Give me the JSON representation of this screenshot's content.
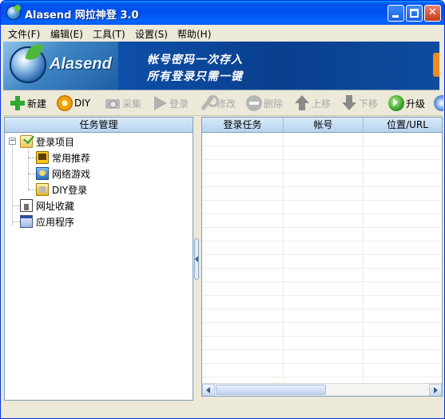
{
  "window": {
    "title": "Alasend 网拉神登 3.0"
  },
  "menu": [
    {
      "label": "文件(F)"
    },
    {
      "label": "编辑(E)"
    },
    {
      "label": "工具(T)"
    },
    {
      "label": "设置(S)"
    },
    {
      "label": "帮助(H)"
    }
  ],
  "banner": {
    "logo_text": "Alasend",
    "slogan_line1": "帐号密码一次存入",
    "slogan_line2": "所有登录只需一键"
  },
  "toolbar": [
    {
      "label": "新建",
      "icon": "plus-icon",
      "enabled": true
    },
    {
      "label": "DIY",
      "icon": "gear-icon",
      "enabled": true
    },
    {
      "label": "采集",
      "icon": "camera-icon",
      "enabled": false
    },
    {
      "label": "登录",
      "icon": "play-icon",
      "enabled": false
    },
    {
      "label": "修改",
      "icon": "wrench-icon",
      "enabled": false
    },
    {
      "label": "删除",
      "icon": "no-entry-icon",
      "enabled": false
    },
    {
      "label": "上移",
      "icon": "arrow-up-icon",
      "enabled": false
    },
    {
      "label": "下移",
      "icon": "arrow-down-icon",
      "enabled": false
    },
    {
      "label": "升级",
      "icon": "upgrade-icon",
      "enabled": true
    }
  ],
  "left_panel": {
    "title": "任务管理",
    "tree": {
      "root": {
        "label": "登录项目",
        "expanded": true,
        "expander": "−"
      },
      "children": [
        {
          "label": "常用推荐"
        },
        {
          "label": "网络游戏"
        },
        {
          "label": "DIY登录"
        }
      ],
      "siblings": [
        {
          "label": "网址收藏"
        },
        {
          "label": "应用程序"
        }
      ]
    }
  },
  "list": {
    "columns": [
      "登录任务",
      "帐号",
      "位置/URL"
    ],
    "rows": []
  },
  "colors": {
    "titlebar": "#0053ee",
    "banner": "#0b3f8f",
    "window_bg": "#ece9d8",
    "header_bg": "#b7d3f0",
    "border": "#7f9db9",
    "disabled_text": "#a8a8a8"
  }
}
